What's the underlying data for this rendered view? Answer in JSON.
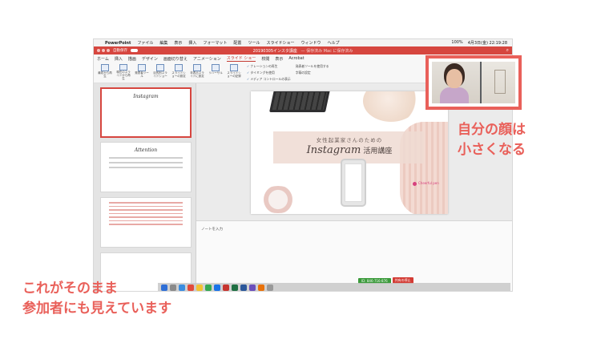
{
  "menubar": {
    "app": "PowerPoint",
    "items": [
      "ファイル",
      "編集",
      "表示",
      "挿入",
      "フォーマット",
      "配置",
      "ツール",
      "スライドショー",
      "ウィンドウ",
      "ヘルプ"
    ],
    "battery": "100%",
    "datetime": "4月3日(金) 22:19:28"
  },
  "titlebar": {
    "autosave": "自動保存",
    "document": "20190305インスタ講座",
    "user": "— 保存済み Mac に保存済み"
  },
  "ribbon": {
    "tabs": [
      "ホーム",
      "挿入",
      "描画",
      "デザイン",
      "画面切り替え",
      "アニメーション",
      "スライド ショー",
      "校閲",
      "表示",
      "Acrobat"
    ],
    "active_tab": "スライド ショー",
    "buttons": [
      "最初から再生",
      "現在のスライドから再生",
      "発表者ツール",
      "目的別スライドショー",
      "スライドショーの設定",
      "非表示スライドに設定",
      "リハーサル",
      "スライドショーの記録"
    ],
    "options": [
      "ナレーションの再生",
      "タイミングを使用",
      "メディア コントロールの表示",
      "発表者ツールを使用する",
      "字幕の設定"
    ]
  },
  "slide": {
    "subtitle": "女性起業家さんのための",
    "title": "Instagram",
    "title_suffix": "活用講座",
    "brand": "Cheerful pen"
  },
  "thumbnails": {
    "numbers": [
      "1",
      "2",
      "3",
      "4"
    ],
    "slide2_title": "Attention"
  },
  "notes": {
    "placeholder": "ノートを入力"
  },
  "sharing": {
    "status": "ID: 846-716-876",
    "stop": "共有の停止"
  },
  "annotations": {
    "face_line1": "自分の顔は",
    "face_line2": "小さくなる",
    "bottom_line1": "これがそのまま",
    "bottom_line2": "参加者にも見えています"
  },
  "colors": {
    "accent": "#e9605a",
    "office_red": "#d6463f"
  }
}
